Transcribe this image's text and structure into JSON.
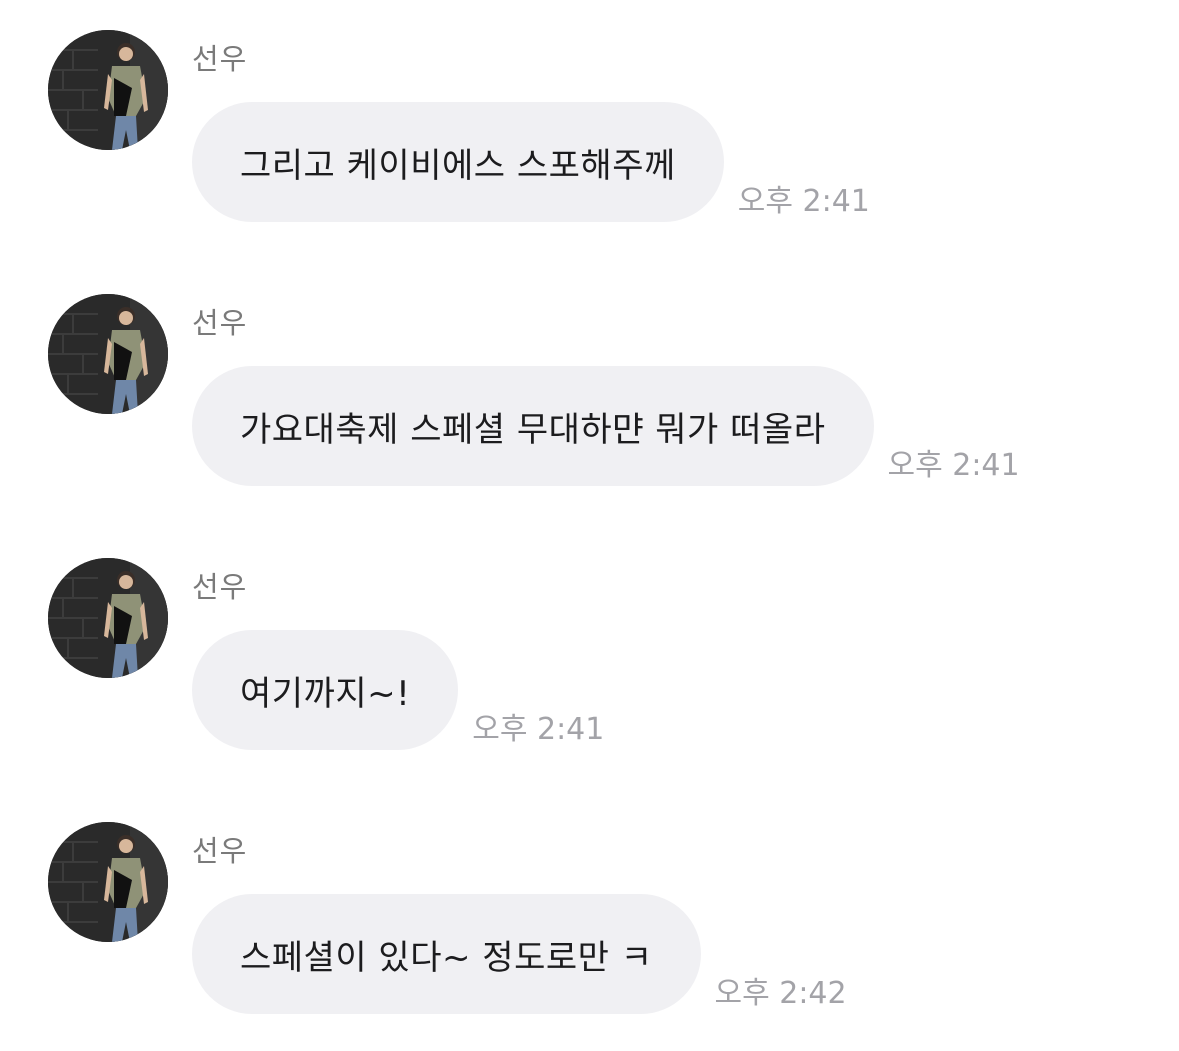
{
  "messages": [
    {
      "sender": "선우",
      "text": "그리고 케이비에스 스포해주께",
      "time": "오후 2:41"
    },
    {
      "sender": "선우",
      "text": "가요대축제 스페셜 무대하먄 뭐가 떠올라",
      "time": "오후 2:41"
    },
    {
      "sender": "선우",
      "text": "여기까지~!",
      "time": "오후 2:41"
    },
    {
      "sender": "선우",
      "text": "스페셜이 있다~ 정도로만 ㅋ",
      "time": "오후 2:42"
    }
  ],
  "avatar_icon": "profile-photo",
  "colors": {
    "bubble": "#f0f0f3",
    "text": "#1c1c1e",
    "sender": "#7a7a7a",
    "timestamp": "#a3a3a8"
  }
}
